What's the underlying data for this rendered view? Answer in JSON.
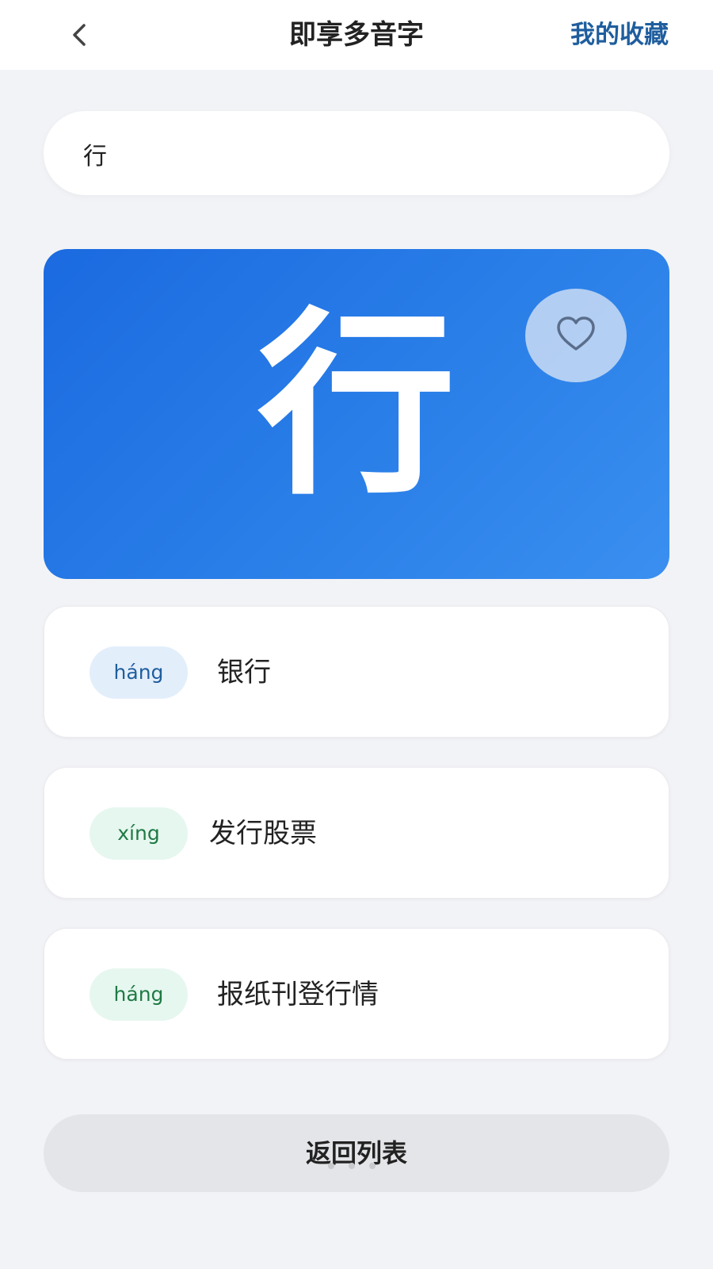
{
  "header": {
    "title": "即享多音字",
    "favorites_label": "我的收藏",
    "back_icon": "chevron-left-icon"
  },
  "search": {
    "value": "行"
  },
  "hero": {
    "character": "行",
    "favorite_icon": "heart-outline-icon",
    "background_color": "#2a7fe8"
  },
  "entries": [
    {
      "pinyin": "háng",
      "word": "银行",
      "pill_color": "#e3eefb",
      "pill_text_color": "#1f5e9e"
    },
    {
      "pinyin": "xíng",
      "word": "发行股票",
      "pill_color": "#e6f7ef",
      "pill_text_color": "#1f7a45"
    },
    {
      "pinyin": "háng",
      "word": "报纸刊登行情",
      "pill_color": "#e6f7ef",
      "pill_text_color": "#1f7a45"
    }
  ],
  "footer": {
    "return_label": "返回列表"
  }
}
